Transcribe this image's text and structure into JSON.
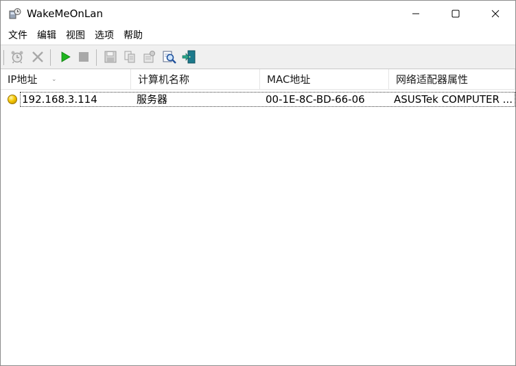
{
  "window": {
    "title": "WakeMeOnLan"
  },
  "menu": [
    "文件",
    "编辑",
    "视图",
    "选项",
    "帮助"
  ],
  "toolbar": {
    "buttons": [
      {
        "name": "wake-button",
        "icon": "alarm-clock-icon",
        "enabled": false
      },
      {
        "name": "delete-button",
        "icon": "close-x-icon",
        "enabled": false
      },
      {
        "name": "start-scan-button",
        "icon": "play-icon",
        "enabled": true,
        "color": "#1fb51f"
      },
      {
        "name": "stop-scan-button",
        "icon": "stop-icon",
        "enabled": false
      },
      {
        "name": "save-button",
        "icon": "floppy-disk-icon",
        "enabled": false
      },
      {
        "name": "copy-button",
        "icon": "copy-icon",
        "enabled": false
      },
      {
        "name": "properties-button",
        "icon": "properties-icon",
        "enabled": false
      },
      {
        "name": "find-button",
        "icon": "find-icon",
        "enabled": true
      },
      {
        "name": "exit-button",
        "icon": "exit-door-icon",
        "enabled": true
      }
    ]
  },
  "table": {
    "columns": [
      "IP地址",
      "计算机名称",
      "MAC地址",
      "网络适配器属性"
    ],
    "sort_indicator": "⌄",
    "rows": [
      {
        "status_color": "#f5c700",
        "ip": "192.168.3.114",
        "name": "服务器",
        "mac": "00-1E-8C-BD-66-06",
        "adapter": "ASUSTek COMPUTER ..."
      }
    ]
  }
}
